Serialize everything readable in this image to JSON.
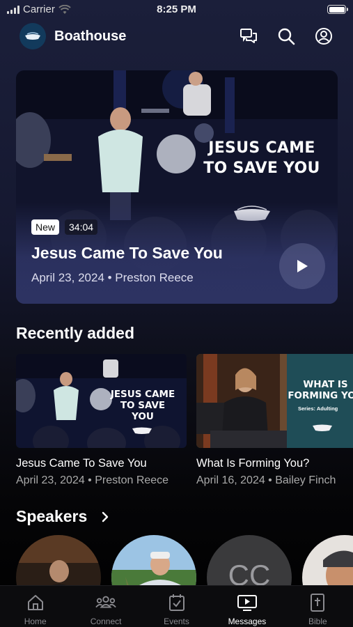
{
  "status_bar": {
    "carrier": "Carrier",
    "time": "8:25 PM"
  },
  "header": {
    "app_title": "Boathouse",
    "icons": [
      "chat-icon",
      "search-icon",
      "profile-icon"
    ]
  },
  "hero": {
    "overlay_text": "JESUS CAME\nTO SAVE YOU",
    "badge": "New",
    "duration": "34:04",
    "title": "Jesus Came To Save You",
    "meta": "April 23, 2024 • Preston Reece"
  },
  "recent": {
    "title": "Recently added",
    "items": [
      {
        "thumb_text": "JESUS CAME\nTO SAVE YOU",
        "title": "Jesus Came To Save You",
        "meta": "April 23, 2024 • Preston Reece"
      },
      {
        "thumb_text": "WHAT IS\nFORMING YOU",
        "thumb_series": "Series: Adulting",
        "title": "What Is Forming You?",
        "meta": "April 16, 2024 • Bailey Finch"
      }
    ]
  },
  "speakers": {
    "title": "Speakers",
    "initials": "CC"
  },
  "tabs": [
    {
      "label": "Home",
      "icon": "home-icon"
    },
    {
      "label": "Connect",
      "icon": "people-icon"
    },
    {
      "label": "Events",
      "icon": "calendar-icon"
    },
    {
      "label": "Messages",
      "icon": "video-icon",
      "active": true
    },
    {
      "label": "Bible",
      "icon": "bible-icon"
    }
  ],
  "colors": {
    "accent_logo": "#123a5c",
    "hero_bg": "#2c3261",
    "background": "#000000"
  }
}
